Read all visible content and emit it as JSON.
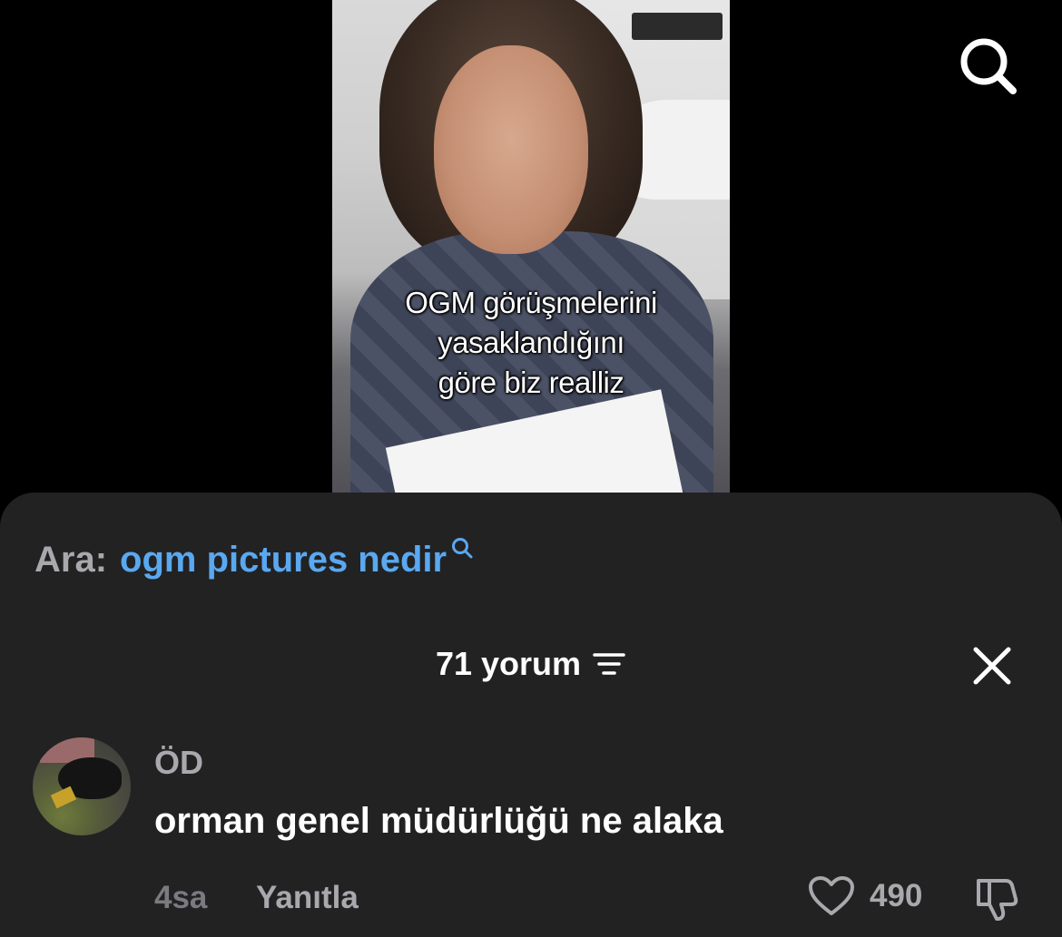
{
  "video": {
    "caption_lines": [
      "OGM görüşmelerini",
      "yasaklandığını",
      "göre biz realliz"
    ]
  },
  "icons": {
    "top_search": "search-icon",
    "inline_search": "search-icon",
    "sort": "sort-icon",
    "close": "close-icon",
    "like": "heart-icon",
    "dislike": "thumbs-down-icon"
  },
  "search_suggestion": {
    "prefix": "Ara:",
    "query": "ogm pictures nedir"
  },
  "comments": {
    "header": "71 yorum",
    "items": [
      {
        "username": "ÖD",
        "text": "orman genel müdürlüğü ne alaka",
        "time": "4sa",
        "reply_label": "Yanıtla",
        "likes": "490"
      }
    ]
  },
  "colors": {
    "sheet_background": "#222223",
    "link_blue": "#5aa8f0",
    "muted_text": "#a8a8ad"
  }
}
